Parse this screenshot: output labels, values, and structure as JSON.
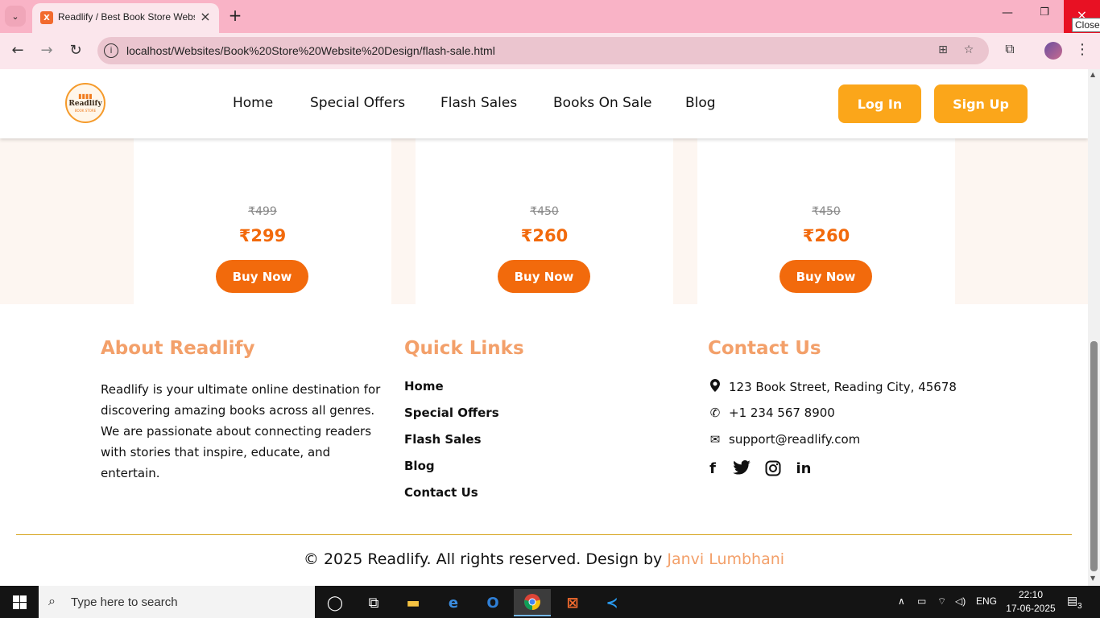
{
  "browser": {
    "tab_title": "Readlify / Best Book Store Website",
    "tab_favicon": "X",
    "url": "localhost/Websites/Book%20Store%20Website%20Design/flash-sale.html",
    "tooltip": "Close"
  },
  "site": {
    "logo_text": "Readlify",
    "logo_sub": "BOOK STORE",
    "nav": [
      "Home",
      "Special Offers",
      "Flash Sales",
      "Books On Sale",
      "Blog"
    ],
    "login_label": "Log In",
    "signup_label": "Sign Up"
  },
  "offers": [
    {
      "old_price": "₹499",
      "new_price": "₹299",
      "buy_label": "Buy Now"
    },
    {
      "old_price": "₹450",
      "new_price": "₹260",
      "buy_label": "Buy Now"
    },
    {
      "old_price": "₹450",
      "new_price": "₹260",
      "buy_label": "Buy Now"
    }
  ],
  "footer": {
    "about_title": "About Readlify",
    "about_text": "Readlify is your ultimate online destination for discovering amazing books across all genres. We are passionate about connecting readers with stories that inspire, educate, and entertain.",
    "links_title": "Quick Links",
    "links": [
      "Home",
      "Special Offers",
      "Flash Sales",
      "Blog",
      "Contact Us"
    ],
    "contact_title": "Contact Us",
    "address": "123 Book Street, Reading City, 45678",
    "phone": "+1 234 567 8900",
    "email": "support@readlify.com",
    "copyright": "© 2025 Readlify. All rights reserved. Design by ",
    "designer": "Janvi Lumbhani"
  },
  "taskbar": {
    "search_placeholder": "Type here to search",
    "language": "ENG",
    "time": "22:10",
    "date": "17-06-2025",
    "notifications": "3"
  },
  "colors": {
    "tab_strip": "#f9b3c6",
    "accent_orange": "#f26a0c",
    "button_yellow": "#fba61a",
    "footer_heading": "#f3a06a"
  }
}
